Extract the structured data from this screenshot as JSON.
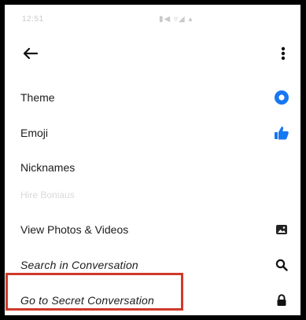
{
  "status_bar": {
    "time": "12:51",
    "icons": "▮◀ ▿◢ ▴"
  },
  "app_bar": {
    "back_icon": "back-arrow-icon",
    "more_icon": "more-vertical-icon"
  },
  "menu": {
    "items": [
      {
        "label": "Theme",
        "icon": "theme-icon"
      },
      {
        "label": "Emoji",
        "icon": "thumbs-up-icon"
      },
      {
        "label": "Nicknames",
        "icon": ""
      },
      {
        "label": "Hire Boniaus",
        "icon": ""
      },
      {
        "label": "View Photos & Videos",
        "icon": "photo-icon"
      },
      {
        "label": "Search in Conversation",
        "icon": "search-icon"
      },
      {
        "label": "Go to Secret Conversation",
        "icon": "lock-icon"
      }
    ]
  },
  "colors": {
    "accent": "#1877f2",
    "highlight_border": "#d0392b",
    "frame": "#000000"
  }
}
